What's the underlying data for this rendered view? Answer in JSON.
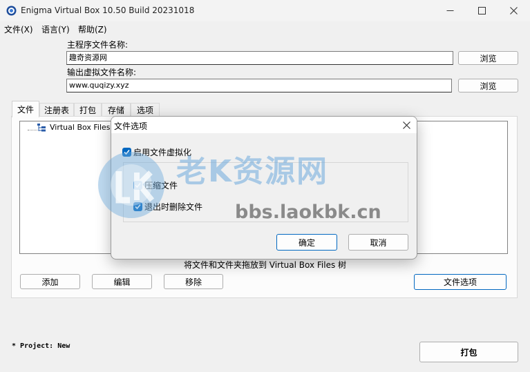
{
  "window": {
    "title": "Enigma Virtual Box 10.50 Build 20231018"
  },
  "menu": {
    "items": [
      "文件(X)",
      "语言(Y)",
      "帮助(Z)"
    ]
  },
  "main_exe": {
    "label": "主程序文件名称:",
    "value": "趣奇资源网",
    "browse_label": "浏览"
  },
  "output_file": {
    "label": "输出虚拟文件名称:",
    "value": "www.quqizy.xyz",
    "browse_label": "浏览"
  },
  "tabs": [
    "文件",
    "注册表",
    "打包",
    "存储",
    "选项"
  ],
  "file_tree": {
    "root_label": "Virtual Box Files"
  },
  "hint": "将文件和文件夹拖放到 Virtual Box Files 树",
  "file_buttons": {
    "add": "添加",
    "edit": "编辑",
    "remove": "移除",
    "file_options": "文件选项"
  },
  "status": {
    "project": "* Project: New"
  },
  "pack_button": "打包",
  "dialog": {
    "title": "文件选项",
    "enable_virtualization": {
      "label": "启用文件虚拟化",
      "checked": true
    },
    "compress_files": {
      "label": "压缩文件",
      "checked": true
    },
    "delete_on_exit": {
      "label": "退出时删除文件",
      "checked": true
    },
    "ok_label": "确定",
    "cancel_label": "取消"
  },
  "watermark": {
    "text": "老K资源网",
    "url": "bbs.laokbk.cn"
  },
  "colors": {
    "accent": "#0067c0",
    "focus_border": "#0067c0",
    "watermark_blue": "#6eaadc"
  }
}
